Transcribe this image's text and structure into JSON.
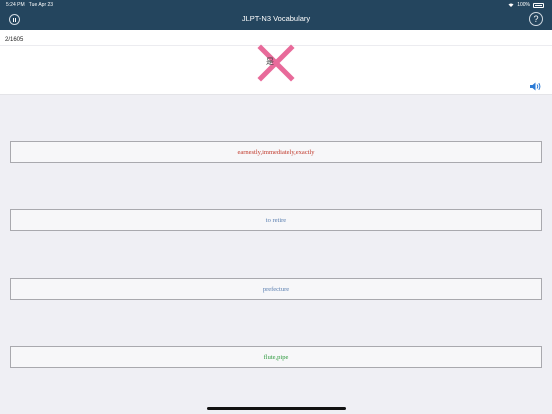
{
  "status_bar": {
    "time": "5:24 PM",
    "date": "Tue Apr 23",
    "battery": "100%",
    "icons": [
      "wifi-icon",
      "battery-icon"
    ]
  },
  "nav": {
    "title": "JLPT-N3 Vocabulary",
    "left_icon": "pause-icon",
    "right_label": "?"
  },
  "question": {
    "progress": "2/1605",
    "word": "是",
    "result_mark": "wrong",
    "icons": [
      "speaker-icon"
    ]
  },
  "options": [
    {
      "label": "earnestly,immediately,exactly",
      "state": "wrong-selected",
      "color": "#c0392b"
    },
    {
      "label": "to retire",
      "state": "neutral",
      "color": "#5a7fb0"
    },
    {
      "label": "prefecture",
      "state": "neutral",
      "color": "#5a7fb0"
    },
    {
      "label": "flute,pipe",
      "state": "correct",
      "color": "#2e9a3e"
    }
  ],
  "colors": {
    "nav_bg": "#24455e",
    "wrong_mark": "#e86a9a",
    "page_bg": "#efeff4"
  }
}
